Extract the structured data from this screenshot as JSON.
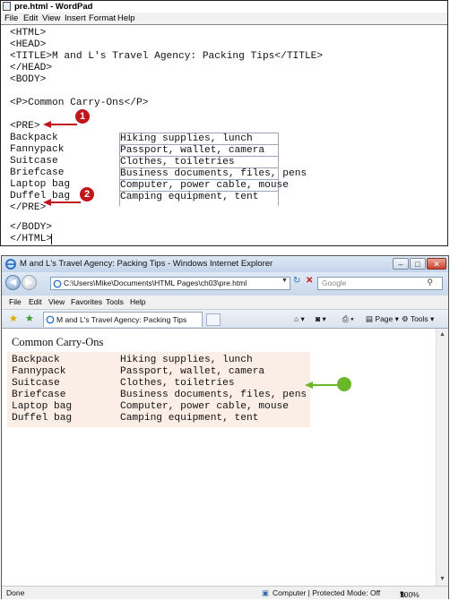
{
  "wordpad": {
    "title": "pre.html - WordPad",
    "menu": [
      "File",
      "Edit",
      "View",
      "Insert",
      "Format",
      "Help"
    ],
    "lines": [
      "<HTML>",
      "<HEAD>",
      "<TITLE>M and L's Travel Agency: Packing Tips</TITLE>",
      "</HEAD>",
      "<BODY>",
      "",
      "<P>Common Carry-Ons</P>",
      "",
      "<PRE>"
    ],
    "pre_rows": [
      {
        "item": "Backpack",
        "desc": "Hiking supplies, lunch"
      },
      {
        "item": "Fannypack",
        "desc": "Passport, wallet, camera"
      },
      {
        "item": "Suitcase",
        "desc": "Clothes, toiletries"
      },
      {
        "item": "Briefcase",
        "desc": "Business documents, files, pens"
      },
      {
        "item": "Laptop bag",
        "desc": "Computer, power cable, mouse"
      },
      {
        "item": "Duffel bag",
        "desc": "Camping equipment, tent"
      }
    ],
    "end_lines": [
      "</PRE>",
      "",
      "</BODY>",
      "</HTML>"
    ],
    "callouts": [
      "1",
      "2"
    ]
  },
  "ie": {
    "title": "M and L's Travel Agency: Packing Tips - Windows Internet Explorer",
    "address": "C:\\Users\\Mike\\Documents\\HTML Pages\\ch03\\pre.html",
    "search_placeholder": "Google",
    "menu": [
      "File",
      "Edit",
      "View",
      "Favorites",
      "Tools",
      "Help"
    ],
    "tab_label": "M and L's Travel Agency: Packing Tips",
    "commands": {
      "page": "Page",
      "tools": "Tools"
    },
    "heading": "Common Carry-Ons",
    "pre_rows": [
      {
        "item": "Backpack",
        "desc": "Hiking supplies, lunch"
      },
      {
        "item": "Fannypack",
        "desc": "Passport, wallet, camera"
      },
      {
        "item": "Suitcase",
        "desc": "Clothes, toiletries"
      },
      {
        "item": "Briefcase",
        "desc": "Business documents, files, pens"
      },
      {
        "item": "Laptop bag",
        "desc": "Computer, power cable, mouse"
      },
      {
        "item": "Duffel bag",
        "desc": "Camping equipment, tent"
      }
    ],
    "status": {
      "left": "Done",
      "zone": "Computer | Protected Mode: Off",
      "zoom": "100%"
    }
  },
  "colors": {
    "callout_red": "#c0161b",
    "callout_green": "#6ab72a",
    "pre_background": "#fbeee6"
  }
}
